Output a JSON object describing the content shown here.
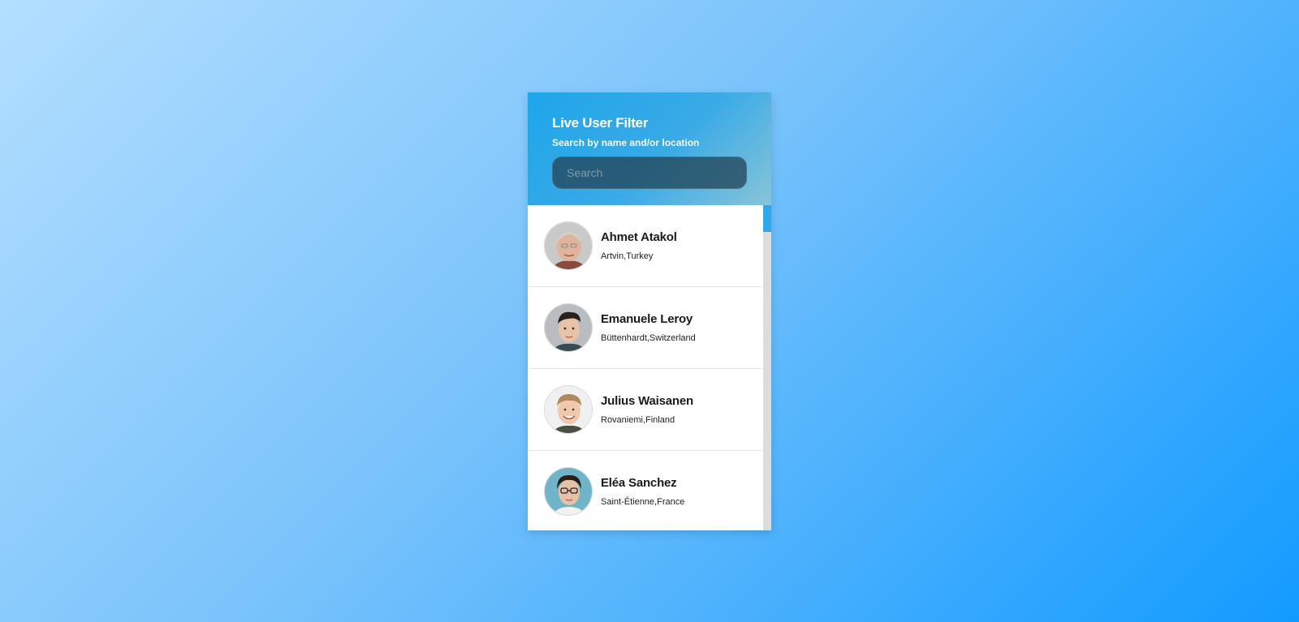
{
  "header": {
    "title": "Live User Filter",
    "subtitle": "Search by name and/or location",
    "search_placeholder": "Search",
    "search_value": ""
  },
  "users": [
    {
      "name": "Ahmet Atakol",
      "location": "Artvin,Turkey",
      "avatar": "avatar-older-man"
    },
    {
      "name": "Emanuele Leroy",
      "location": "Büttenhardt,Switzerland",
      "avatar": "avatar-young-man"
    },
    {
      "name": "Julius Waisanen",
      "location": "Rovaniemi,Finland",
      "avatar": "avatar-smiling-man"
    },
    {
      "name": "Eléa Sanchez",
      "location": "Saint-Étienne,France",
      "avatar": "avatar-woman-glasses"
    }
  ],
  "colors": {
    "header_gradient_start": "#1ea6ea",
    "header_gradient_end": "#86c4d9",
    "scroll_thumb": "#2ea8ec",
    "page_gradient_start": "#b3dfff",
    "page_gradient_end": "#129bff"
  }
}
